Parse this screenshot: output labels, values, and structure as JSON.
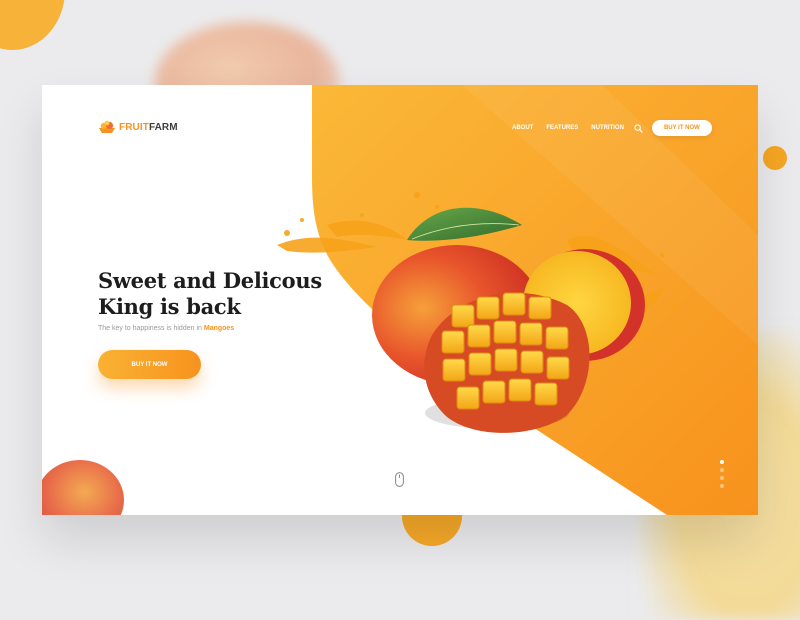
{
  "brand": {
    "name_part1": "FRUIT",
    "name_part2": "FARM",
    "accent_color": "#f7931e",
    "logo_icon": "fruit-basket-icon"
  },
  "nav": {
    "links": [
      "ABOUT",
      "FEATURES",
      "NUTRITION"
    ],
    "search_icon": "search-icon",
    "cta_label": "BUY IT NOW"
  },
  "hero": {
    "title": "Sweet and Delicous King is back",
    "subtitle_prefix": "The key to happiness is hidden in ",
    "subtitle_highlight": "Mangoes",
    "cta_label": "BUY IT NOW"
  },
  "carousel": {
    "slides_count": 4,
    "active_slide": 1
  },
  "scroll_indicator_icon": "mouse-scroll-icon"
}
